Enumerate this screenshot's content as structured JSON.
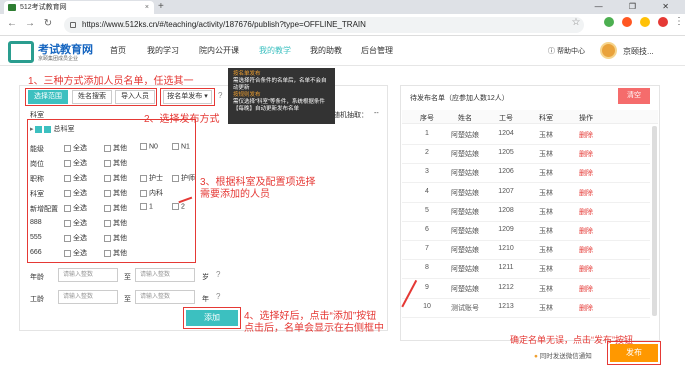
{
  "browser": {
    "tab_title": "512考试教育网",
    "tab_close": "×",
    "new_tab": "+",
    "window_controls": "— ❐ ✕",
    "url": "https://www.512ks.cn/#/teaching/activity/187676/publish?type=OFFLINE_TRAIN"
  },
  "header": {
    "logo_title": "考试教育网",
    "logo_sub": "京颐集团成员企业",
    "nav": [
      "首页",
      "我的学习",
      "院内公开课",
      "我的教学",
      "我的助教",
      "后台管理"
    ],
    "help": "帮助中心",
    "user": "京颐技..."
  },
  "annotations": {
    "a1": "1、三种方式添加人员名单，任选其一",
    "a2": "2、选择发布方式",
    "a3": "3、根据科室及配置项选择需要添加的人员",
    "a4_1": "4、选择好后，点击“添加”按钮",
    "a4_2": "点击后，名单会显示在右侧框中",
    "a5": "确定名单无误，点击“发布”按钮"
  },
  "left": {
    "tabs": [
      "选择范围",
      "姓名搜索",
      "导入人员"
    ],
    "publish_mode": "按名单发布 ▾",
    "dept_label": "科室",
    "random_label": "随机抽取：",
    "random_value": "--",
    "tree_root": "总科室",
    "rows": [
      {
        "label": "能级",
        "opts": [
          "全选",
          "其他",
          "N0",
          "N1"
        ]
      },
      {
        "label": "岗位",
        "opts": [
          "全选",
          "其他"
        ]
      },
      {
        "label": "职称",
        "opts": [
          "全选",
          "其他",
          "护士",
          "护师"
        ]
      },
      {
        "label": "科室",
        "opts": [
          "全选",
          "其他",
          "内科"
        ]
      },
      {
        "label": "新增配置",
        "opts": [
          "全选",
          "其他",
          "1",
          "2"
        ]
      },
      {
        "label": "888",
        "opts": [
          "全选",
          "其他"
        ]
      },
      {
        "label": "555",
        "opts": [
          "全选",
          "其他"
        ]
      },
      {
        "label": "666",
        "opts": [
          "全选",
          "其他"
        ]
      }
    ],
    "age_label": "年龄",
    "age_ph": "请输入整数",
    "to": "至",
    "age_unit": "岁",
    "seniority_label": "工龄",
    "seniority_ph": "请输入整数",
    "seniority_unit": "年",
    "add_btn": "添加"
  },
  "tooltip": {
    "h1": "按名单发布",
    "t1": "需选择符合条件的名单后，名单不会自动更新",
    "h2": "按规则发布",
    "t2": "需仅选择\"科室\"等条件，系统根据条件【每晚】自动更新发布名单"
  },
  "right": {
    "title": "待发布名单（应参加人数12人）",
    "clear_btn": "清空",
    "cols": [
      "序号",
      "姓名",
      "工号",
      "科室",
      "操作"
    ],
    "rows": [
      [
        "1",
        "阿楚姑娘",
        "1204",
        "玉林",
        "删除"
      ],
      [
        "2",
        "阿楚姑娘",
        "1205",
        "玉林",
        "删除"
      ],
      [
        "3",
        "阿楚姑娘",
        "1206",
        "玉林",
        "删除"
      ],
      [
        "4",
        "阿楚姑娘",
        "1207",
        "玉林",
        "删除"
      ],
      [
        "5",
        "阿楚姑娘",
        "1208",
        "玉林",
        "删除"
      ],
      [
        "6",
        "阿楚姑娘",
        "1209",
        "玉林",
        "删除"
      ],
      [
        "7",
        "阿楚姑娘",
        "1210",
        "玉林",
        "删除"
      ],
      [
        "8",
        "阿楚姑娘",
        "1211",
        "玉林",
        "删除"
      ],
      [
        "9",
        "阿楚姑娘",
        "1212",
        "玉林",
        "删除"
      ],
      [
        "10",
        "测试账号",
        "1213",
        "玉林",
        "删除"
      ]
    ],
    "notify": "同时发送微信通知",
    "publish_btn": "发布"
  }
}
